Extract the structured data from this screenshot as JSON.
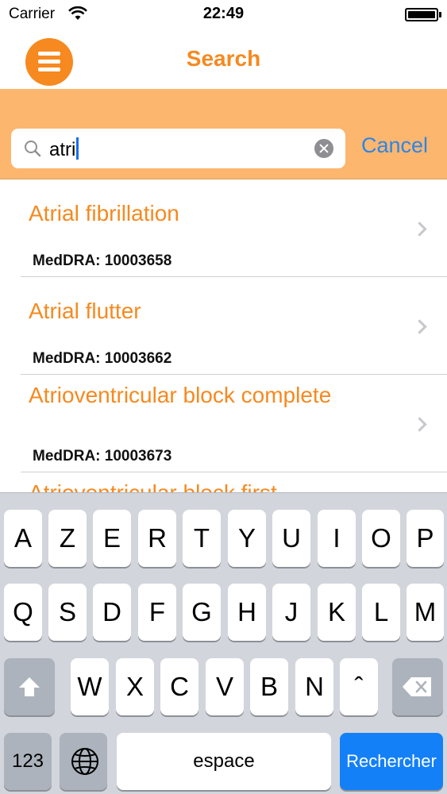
{
  "status_bar": {
    "carrier": "Carrier",
    "time": "22:49"
  },
  "navbar": {
    "title": "Search",
    "menu_icon": "hamburger-icon"
  },
  "search": {
    "value": "atri",
    "cancel_label": "Cancel"
  },
  "results": [
    {
      "title": "Atrial fibrillation",
      "code": "MedDRA: 10003658"
    },
    {
      "title": "Atrial flutter",
      "code": "MedDRA: 10003662"
    },
    {
      "title": "Atrioventricular block complete",
      "code": "MedDRA: 10003673"
    },
    {
      "title": "Atrioventricular block first",
      "code": ""
    }
  ],
  "keyboard": {
    "row1": [
      "A",
      "Z",
      "E",
      "R",
      "T",
      "Y",
      "U",
      "I",
      "O",
      "P"
    ],
    "row2": [
      "Q",
      "S",
      "D",
      "F",
      "G",
      "H",
      "J",
      "K",
      "L",
      "M"
    ],
    "row3": [
      "W",
      "X",
      "C",
      "V",
      "B",
      "N",
      "ˆ"
    ],
    "numbers_label": "123",
    "space_label": "espace",
    "search_label": "Rechercher"
  },
  "colors": {
    "accent": "#f6891f",
    "search_bg": "#fdb66e",
    "link_blue": "#2a86e8",
    "keyboard_bg": "#d2d5db",
    "search_key": "#1480f8"
  }
}
